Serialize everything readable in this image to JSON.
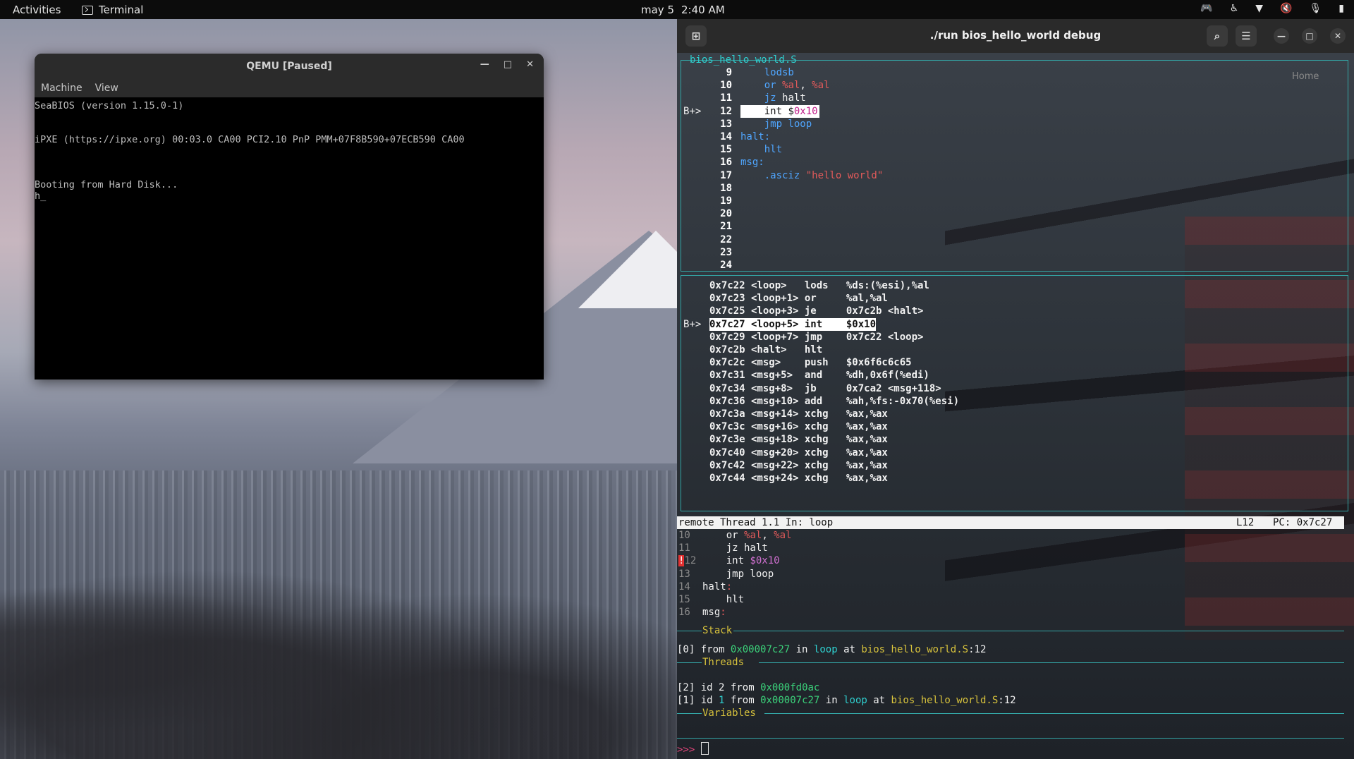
{
  "topbar": {
    "activities": "Activities",
    "app_name": "Terminal",
    "date": "may 5",
    "time": "2:40 AM",
    "tray_icons": [
      "discord-icon",
      "accessibility-icon",
      "wifi-icon",
      "volume-muted-icon",
      "mic-muted-icon",
      "battery-icon"
    ]
  },
  "qemu": {
    "title": "QEMU [Paused]",
    "menu": [
      "Machine",
      "View"
    ],
    "screen_lines": [
      "SeaBIOS (version 1.15.0-1)",
      "",
      "",
      "iPXE (https://ipxe.org) 00:03.0 CA00 PCI2.10 PnP PMM+07F8B590+07ECB590 CA00",
      "",
      "",
      "",
      "Booting from Hard Disk...",
      "h_"
    ]
  },
  "terminal": {
    "title": "./run bios_hello_world debug",
    "source_pane": {
      "title": "bios_hello_world.S",
      "lines": [
        {
          "mark": "",
          "num": "9",
          "code": [
            [
              "kw",
              "    lodsb"
            ]
          ]
        },
        {
          "mark": "",
          "num": "10",
          "code": [
            [
              "kw",
              "    or "
            ],
            [
              "reg",
              "%al"
            ],
            [
              "white",
              ", "
            ],
            [
              "reg",
              "%al"
            ]
          ]
        },
        {
          "mark": "",
          "num": "11",
          "code": [
            [
              "kw",
              "    jz "
            ],
            [
              "white",
              "halt"
            ]
          ]
        },
        {
          "mark": "B+>",
          "num": "12",
          "hl": true,
          "code": [
            [
              "kw",
              "    int "
            ],
            [
              "white",
              "$"
            ],
            [
              "imm",
              "0x10"
            ]
          ]
        },
        {
          "mark": "",
          "num": "13",
          "code": [
            [
              "kw",
              "    jmp loop"
            ]
          ]
        },
        {
          "mark": "",
          "num": "14",
          "code": [
            [
              "lbl",
              "halt:"
            ]
          ]
        },
        {
          "mark": "",
          "num": "15",
          "code": [
            [
              "kw",
              "    hlt"
            ]
          ]
        },
        {
          "mark": "",
          "num": "16",
          "code": [
            [
              "lbl",
              "msg:"
            ]
          ]
        },
        {
          "mark": "",
          "num": "17",
          "code": [
            [
              "kw",
              "    .asciz "
            ],
            [
              "str",
              "\"hello world\""
            ]
          ]
        },
        {
          "mark": "",
          "num": "18",
          "code": []
        },
        {
          "mark": "",
          "num": "19",
          "code": []
        },
        {
          "mark": "",
          "num": "20",
          "code": []
        },
        {
          "mark": "",
          "num": "21",
          "code": []
        },
        {
          "mark": "",
          "num": "22",
          "code": []
        },
        {
          "mark": "",
          "num": "23",
          "code": []
        },
        {
          "mark": "",
          "num": "24",
          "code": []
        }
      ]
    },
    "asm_pane": {
      "lines": [
        {
          "mark": "",
          "text": "0x7c22 <loop>   lods   %ds:(%esi),%al"
        },
        {
          "mark": "",
          "text": "0x7c23 <loop+1> or     %al,%al"
        },
        {
          "mark": "",
          "text": "0x7c25 <loop+3> je     0x7c2b <halt>"
        },
        {
          "mark": "B+>",
          "text": "0x7c27 <loop+5> int    $0x10",
          "hl": true
        },
        {
          "mark": "",
          "text": "0x7c29 <loop+7> jmp    0x7c22 <loop>"
        },
        {
          "mark": "",
          "text": "0x7c2b <halt>   hlt"
        },
        {
          "mark": "",
          "text": "0x7c2c <msg>    push   $0x6f6c6c65"
        },
        {
          "mark": "",
          "text": "0x7c31 <msg+5>  and    %dh,0x6f(%edi)"
        },
        {
          "mark": "",
          "text": "0x7c34 <msg+8>  jb     0x7ca2 <msg+118>"
        },
        {
          "mark": "",
          "text": "0x7c36 <msg+10> add    %ah,%fs:-0x70(%esi)"
        },
        {
          "mark": "",
          "text": "0x7c3a <msg+14> xchg   %ax,%ax"
        },
        {
          "mark": "",
          "text": "0x7c3c <msg+16> xchg   %ax,%ax"
        },
        {
          "mark": "",
          "text": "0x7c3e <msg+18> xchg   %ax,%ax"
        },
        {
          "mark": "",
          "text": "0x7c40 <msg+20> xchg   %ax,%ax"
        },
        {
          "mark": "",
          "text": "0x7c42 <msg+22> xchg   %ax,%ax"
        },
        {
          "mark": "",
          "text": "0x7c44 <msg+24> xchg   %ax,%ax"
        }
      ]
    },
    "status": {
      "left": "remote Thread 1.1 In: loop",
      "line": "L12",
      "pc": "PC: 0x7c27"
    },
    "dashboard_source": [
      {
        "num": "10",
        "code": [
          [
            "white",
            "    or "
          ],
          [
            "reg",
            "%al"
          ],
          [
            "white",
            ", "
          ],
          [
            "reg",
            "%al"
          ]
        ]
      },
      {
        "num": "11",
        "code": [
          [
            "white",
            "    jz halt"
          ]
        ]
      },
      {
        "num": "!12",
        "current": true,
        "code": [
          [
            "white",
            "    int "
          ],
          [
            "imm",
            "$0x10"
          ]
        ]
      },
      {
        "num": "13",
        "code": [
          [
            "white",
            "    jmp loop"
          ]
        ]
      },
      {
        "num": "14",
        "code": [
          [
            "white",
            "halt"
          ],
          [
            "reg",
            ":"
          ]
        ]
      },
      {
        "num": "15",
        "code": [
          [
            "white",
            "    hlt"
          ]
        ]
      },
      {
        "num": "16",
        "code": [
          [
            "white",
            "msg"
          ],
          [
            "reg",
            ":"
          ]
        ]
      }
    ],
    "sections": {
      "stack": "Stack",
      "threads": "Threads",
      "variables": "Variables"
    },
    "stack_frame": {
      "idx": "[0]",
      "from": "from",
      "addr": "0x00007c27",
      "in": "in",
      "func": "loop",
      "at": "at",
      "file": "bios_hello_world.S",
      "line": ":12"
    },
    "threads": [
      {
        "idx": "[2]",
        "id_label": "id",
        "id": "2",
        "from": "from",
        "addr": "0x000fd0ac"
      },
      {
        "idx": "[1]",
        "id_label": "id",
        "id": "1",
        "from": "from",
        "addr": "0x00007c27",
        "in": "in",
        "func": "loop",
        "at": "at",
        "file": "bios_hello_world.S",
        "line": ":12"
      }
    ],
    "prompt": ">>>",
    "wallpaper_text": "Home"
  },
  "colors": {
    "pane_border": "#33a5a5",
    "keyword": "#4fa6ff",
    "register": "#e35a5a",
    "immediate": "#d070d0",
    "address": "#3bd17a",
    "file": "#d7c23c"
  }
}
